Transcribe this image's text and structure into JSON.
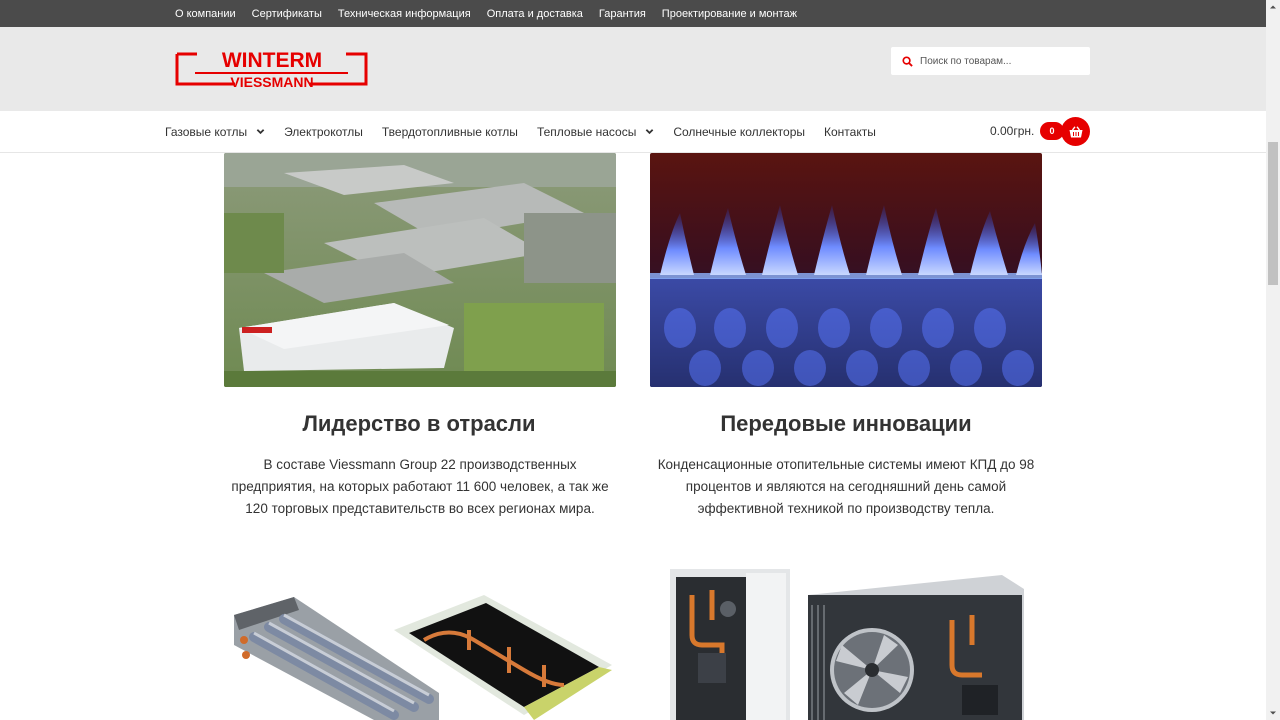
{
  "topbar": {
    "links": [
      "О компании",
      "Сертификаты",
      "Техническая информация",
      "Оплата и доставка",
      "Гарантия",
      "Проектирование и монтаж"
    ]
  },
  "header": {
    "logo_top": "WINTERM",
    "logo_bottom": "VIESSMANN",
    "search_placeholder": "Поиск по товарам...",
    "brand_color": "#e60000"
  },
  "nav": {
    "items": [
      {
        "label": "Газовые котлы",
        "dropdown": true
      },
      {
        "label": "Электрокотлы",
        "dropdown": false
      },
      {
        "label": "Твердотопливные котлы",
        "dropdown": false
      },
      {
        "label": "Тепловые насосы",
        "dropdown": true
      },
      {
        "label": "Солнечные коллекторы",
        "dropdown": false
      },
      {
        "label": "Контакты",
        "dropdown": false
      }
    ],
    "cart_total": "0.00грн.",
    "cart_count": "0"
  },
  "features": [
    {
      "title": "Лидерство в отрасли",
      "text": "В составе Viessmann Group 22 производственных предприятия, на которых работают 11 600 человек, а так же 120 торговых представительств во всех регионах мира."
    },
    {
      "title": "Передовые инновации",
      "text": "Конденсационные отопительные системы имеют КПД до 98 процентов и являются на сегодняшний день самой эффективной техникой по производству тепла."
    }
  ]
}
